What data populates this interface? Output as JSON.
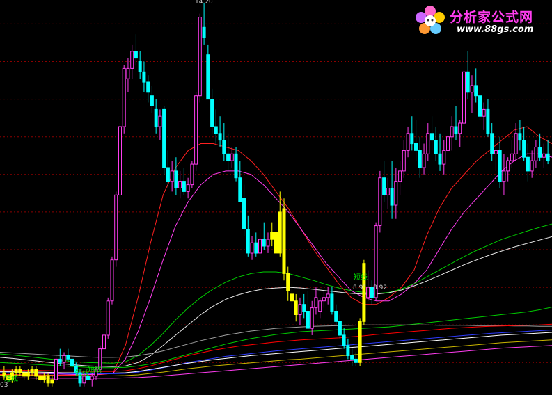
{
  "watermark": {
    "title": "分析家公式网",
    "url": "www.88gs.com",
    "icon": "flower-logo-icon",
    "title_color": "#ff3df0"
  },
  "colors": {
    "up_candle": "#ff3df0",
    "down_candle": "#00ffff",
    "signal_candle": "#ffff00",
    "gridline": "#8b0000"
  },
  "chart_data": {
    "type": "candlestick",
    "ylim": [
      2.75,
      14.3
    ],
    "grid": "horizontal-dotted",
    "gridline_values": [
      13.6,
      12.5,
      11.4,
      10.3,
      9.2,
      8.1,
      7.0,
      5.9,
      4.8,
      3.7,
      2.6
    ],
    "high_label": "14.20",
    "range_label": "8.91 - 8.92",
    "signal_label": "短线",
    "corner_label": "03",
    "candles": [
      [
        3.4,
        3.6,
        3.2,
        3.3
      ],
      [
        3.3,
        3.4,
        3.1,
        3.2
      ],
      [
        3.2,
        3.5,
        3.1,
        3.4
      ],
      [
        3.4,
        3.6,
        3.3,
        3.5
      ],
      [
        3.5,
        3.6,
        3.3,
        3.4
      ],
      [
        3.4,
        3.5,
        3.2,
        3.3
      ],
      [
        3.3,
        3.5,
        3.2,
        3.4
      ],
      [
        3.4,
        3.6,
        3.3,
        3.5
      ],
      [
        3.5,
        3.6,
        3.2,
        3.3
      ],
      [
        3.3,
        3.4,
        3.1,
        3.2
      ],
      [
        3.2,
        3.4,
        3.1,
        3.3
      ],
      [
        3.3,
        3.4,
        3.0,
        3.1
      ],
      [
        3.1,
        3.3,
        3.0,
        3.2
      ],
      [
        3.2,
        3.9,
        3.1,
        3.8
      ],
      [
        3.8,
        4.1,
        3.6,
        3.7
      ],
      [
        3.7,
        4.0,
        3.5,
        3.9
      ],
      [
        3.9,
        4.1,
        3.7,
        3.8
      ],
      [
        3.8,
        3.9,
        3.5,
        3.6
      ],
      [
        3.6,
        3.7,
        3.3,
        3.4
      ],
      [
        3.4,
        3.5,
        3.0,
        3.1
      ],
      [
        3.1,
        3.4,
        3.0,
        3.3
      ],
      [
        3.3,
        3.5,
        3.1,
        3.2
      ],
      [
        3.2,
        3.4,
        3.0,
        3.3
      ],
      [
        3.3,
        3.6,
        3.2,
        3.5
      ],
      [
        3.5,
        4.2,
        3.4,
        4.1
      ],
      [
        4.1,
        4.6,
        4.0,
        4.5
      ],
      [
        4.5,
        5.6,
        4.4,
        5.5
      ],
      [
        5.5,
        6.8,
        5.4,
        6.7
      ],
      [
        6.7,
        8.7,
        6.5,
        8.6
      ],
      [
        8.6,
        10.7,
        8.4,
        10.6
      ],
      [
        10.6,
        12.4,
        10.4,
        12.3
      ],
      [
        12.0,
        12.6,
        11.6,
        12.3
      ],
      [
        12.3,
        13.0,
        12.0,
        12.8
      ],
      [
        12.8,
        13.3,
        12.4,
        12.6
      ],
      [
        12.5,
        12.8,
        12.0,
        12.2
      ],
      [
        12.2,
        12.5,
        11.6,
        11.9
      ],
      [
        11.9,
        12.1,
        11.3,
        11.6
      ],
      [
        11.5,
        11.8,
        11.0,
        11.2
      ],
      [
        11.1,
        11.4,
        10.4,
        10.6
      ],
      [
        10.6,
        11.1,
        10.2,
        10.9
      ],
      [
        11.1,
        11.2,
        9.2,
        9.4
      ],
      [
        9.4,
        9.9,
        8.8,
        9.0
      ],
      [
        9.0,
        9.6,
        8.7,
        9.3
      ],
      [
        9.3,
        9.7,
        8.6,
        8.8
      ],
      [
        8.8,
        9.3,
        8.5,
        9.0
      ],
      [
        9.0,
        9.4,
        8.6,
        8.7
      ],
      [
        8.7,
        9.1,
        8.5,
        8.9
      ],
      [
        8.9,
        9.6,
        8.8,
        9.5
      ],
      [
        9.5,
        11.6,
        9.3,
        11.5
      ],
      [
        11.5,
        13.9,
        11.3,
        13.8
      ],
      [
        13.5,
        14.2,
        13.0,
        13.2
      ],
      [
        12.7,
        13.0,
        11.8,
        11.4
      ],
      [
        11.4,
        11.7,
        10.4,
        10.6
      ],
      [
        10.6,
        11.1,
        10.1,
        10.4
      ],
      [
        10.4,
        10.9,
        10.0,
        10.2
      ],
      [
        10.2,
        10.7,
        9.6,
        9.8
      ],
      [
        9.8,
        10.4,
        9.3,
        9.6
      ],
      [
        9.6,
        10.0,
        9.4,
        9.8
      ],
      [
        9.8,
        10.0,
        9.0,
        9.1
      ],
      [
        9.1,
        9.6,
        8.6,
        8.4
      ],
      [
        8.5,
        8.9,
        7.4,
        7.6
      ],
      [
        7.6,
        8.0,
        6.8,
        6.9
      ],
      [
        6.9,
        7.4,
        6.7,
        7.2
      ],
      [
        7.2,
        7.5,
        6.8,
        6.9
      ],
      [
        6.9,
        7.6,
        6.8,
        7.3
      ],
      [
        7.3,
        7.8,
        7.0,
        7.1
      ],
      [
        7.1,
        7.5,
        6.9,
        7.3
      ],
      [
        7.3,
        7.8,
        7.1,
        7.5
      ],
      [
        7.5,
        7.6,
        6.7,
        6.9
      ],
      [
        6.9,
        8.7,
        6.8,
        8.1
      ],
      [
        8.2,
        8.5,
        6.1,
        6.3
      ],
      [
        6.3,
        6.5,
        5.5,
        5.8
      ],
      [
        5.7,
        6.0,
        5.3,
        5.5
      ],
      [
        5.5,
        5.7,
        4.9,
        5.1
      ],
      [
        5.1,
        5.6,
        4.8,
        5.4
      ],
      [
        5.4,
        5.7,
        5.0,
        5.2
      ],
      [
        5.2,
        5.8,
        4.9,
        4.7
      ],
      [
        4.7,
        5.5,
        4.5,
        5.3
      ],
      [
        5.3,
        5.9,
        5.1,
        5.6
      ],
      [
        5.2,
        5.6,
        5.0,
        5.5
      ],
      [
        5.5,
        5.8,
        5.3,
        5.6
      ],
      [
        5.6,
        5.9,
        5.4,
        5.7
      ],
      [
        5.7,
        5.9,
        5.1,
        5.2
      ],
      [
        5.2,
        5.4,
        4.8,
        4.9
      ],
      [
        4.9,
        5.1,
        4.4,
        4.5
      ],
      [
        4.5,
        4.7,
        4.1,
        4.2
      ],
      [
        4.2,
        4.4,
        3.8,
        3.9
      ],
      [
        3.9,
        4.1,
        3.6,
        3.8
      ],
      [
        3.8,
        4.0,
        3.6,
        3.7
      ],
      [
        3.7,
        5.0,
        3.6,
        4.9
      ],
      [
        4.9,
        6.7,
        4.8,
        6.6
      ],
      [
        5.6,
        6.4,
        5.5,
        5.9
      ],
      [
        5.9,
        6.1,
        5.4,
        5.6
      ],
      [
        5.6,
        7.8,
        5.5,
        7.7
      ],
      [
        7.7,
        9.3,
        7.5,
        9.1
      ],
      [
        9.1,
        9.6,
        8.4,
        8.6
      ],
      [
        8.6,
        9.1,
        8.2,
        8.8
      ],
      [
        8.8,
        9.6,
        7.9,
        8.3
      ],
      [
        8.3,
        9.4,
        7.9,
        9.0
      ],
      [
        9.0,
        9.6,
        8.6,
        9.3
      ],
      [
        9.3,
        10.2,
        9.1,
        9.9
      ],
      [
        9.9,
        10.6,
        9.7,
        10.4
      ],
      [
        10.4,
        10.9,
        9.9,
        10.1
      ],
      [
        10.1,
        10.8,
        9.6,
        9.9
      ],
      [
        9.9,
        10.3,
        9.1,
        9.4
      ],
      [
        9.4,
        10.1,
        9.2,
        9.8
      ],
      [
        9.8,
        10.7,
        9.6,
        10.4
      ],
      [
        10.4,
        10.9,
        9.9,
        10.2
      ],
      [
        10.2,
        10.6,
        9.6,
        9.8
      ],
      [
        9.8,
        10.4,
        9.3,
        9.5
      ],
      [
        9.5,
        10.2,
        9.2,
        9.9
      ],
      [
        9.9,
        10.6,
        9.6,
        10.3
      ],
      [
        10.3,
        10.9,
        9.9,
        10.6
      ],
      [
        10.6,
        11.2,
        10.2,
        10.4
      ],
      [
        10.4,
        10.8,
        10.0,
        10.7
      ],
      [
        10.7,
        12.6,
        10.5,
        12.2
      ],
      [
        12.2,
        12.8,
        11.4,
        11.6
      ],
      [
        11.6,
        12.1,
        11.0,
        11.8
      ],
      [
        11.8,
        12.3,
        11.3,
        11.5
      ],
      [
        11.5,
        11.8,
        10.8,
        10.9
      ],
      [
        10.9,
        11.3,
        10.5,
        11.1
      ],
      [
        11.1,
        11.4,
        10.3,
        10.4
      ],
      [
        10.4,
        10.7,
        9.6,
        9.8
      ],
      [
        9.8,
        10.2,
        9.3,
        9.9
      ],
      [
        9.9,
        10.3,
        8.8,
        9.0
      ],
      [
        9.0,
        9.8,
        8.6,
        9.3
      ],
      [
        9.3,
        9.7,
        9.0,
        9.6
      ],
      [
        9.6,
        10.2,
        9.4,
        9.8
      ],
      [
        9.8,
        10.7,
        9.6,
        10.4
      ],
      [
        10.4,
        10.8,
        9.9,
        10.2
      ],
      [
        10.2,
        10.6,
        9.6,
        9.7
      ],
      [
        9.7,
        10.1,
        9.0,
        9.3
      ],
      [
        9.3,
        9.9,
        9.1,
        9.6
      ],
      [
        9.6,
        10.2,
        9.4,
        10.0
      ],
      [
        10.0,
        10.4,
        9.6,
        9.7
      ],
      [
        9.7,
        10.1,
        9.4,
        9.8
      ],
      [
        9.8,
        10.2,
        9.5,
        9.6
      ]
    ],
    "signal_bars": [
      0,
      1,
      2,
      3,
      4,
      5,
      6,
      7,
      8,
      9,
      10,
      11,
      12,
      67,
      68,
      69,
      70,
      71,
      72,
      73,
      89,
      90
    ],
    "series": [
      {
        "color": "#ff2020",
        "values": [
          3.35,
          3.35,
          3.34,
          3.34,
          3.33,
          3.33,
          3.33,
          3.34,
          3.35,
          3.38,
          4.2,
          5.6,
          7.2,
          8.6,
          9.4,
          9.9,
          10.1,
          10.1,
          10.0,
          9.9,
          9.6,
          9.2,
          8.7,
          8.2,
          7.6,
          7.0,
          6.5,
          6.0,
          5.6,
          5.4,
          5.4,
          5.6,
          5.9,
          6.4,
          7.4,
          8.2,
          8.8,
          9.2,
          9.6,
          9.9,
          10.2,
          10.5,
          10.6,
          10.3,
          10.1
        ]
      },
      {
        "color": "#ff3df0",
        "values": [
          3.4,
          3.4,
          3.39,
          3.38,
          3.37,
          3.36,
          3.35,
          3.35,
          3.36,
          3.38,
          3.8,
          4.6,
          5.6,
          6.7,
          7.7,
          8.4,
          8.9,
          9.2,
          9.3,
          9.3,
          9.2,
          8.9,
          8.5,
          8.1,
          7.6,
          7.1,
          6.6,
          6.2,
          5.8,
          5.6,
          5.5,
          5.5,
          5.7,
          6.0,
          6.4,
          7.0,
          7.6,
          8.1,
          8.5,
          8.9,
          9.3,
          9.6,
          9.8,
          9.8,
          9.7
        ]
      },
      {
        "color": "#00cc00",
        "values": [
          3.95,
          3.92,
          3.88,
          3.84,
          3.8,
          3.76,
          3.72,
          3.7,
          3.69,
          3.68,
          3.72,
          3.9,
          4.2,
          4.55,
          4.95,
          5.3,
          5.6,
          5.85,
          6.05,
          6.2,
          6.3,
          6.35,
          6.35,
          6.3,
          6.2,
          6.1,
          5.98,
          5.88,
          5.8,
          5.75,
          5.72,
          5.75,
          5.85,
          6.0,
          6.2,
          6.4,
          6.6,
          6.8,
          6.98,
          7.14,
          7.3,
          7.42,
          7.54,
          7.65,
          7.75
        ]
      },
      {
        "color": "#e8e8e8",
        "values": [
          3.85,
          3.82,
          3.78,
          3.74,
          3.7,
          3.66,
          3.63,
          3.6,
          3.59,
          3.58,
          3.6,
          3.7,
          3.9,
          4.2,
          4.5,
          4.8,
          5.1,
          5.35,
          5.55,
          5.68,
          5.78,
          5.85,
          5.88,
          5.9,
          5.88,
          5.84,
          5.8,
          5.76,
          5.72,
          5.7,
          5.7,
          5.74,
          5.82,
          5.94,
          6.08,
          6.24,
          6.4,
          6.56,
          6.7,
          6.84,
          6.96,
          7.08,
          7.18,
          7.28,
          7.38
        ]
      },
      {
        "color": "#00cc00",
        "values": [
          3.7,
          3.68,
          3.66,
          3.64,
          3.62,
          3.6,
          3.58,
          3.56,
          3.55,
          3.55,
          3.56,
          3.6,
          3.66,
          3.74,
          3.84,
          3.94,
          4.04,
          4.14,
          4.24,
          4.32,
          4.4,
          4.46,
          4.52,
          4.56,
          4.6,
          4.62,
          4.64,
          4.66,
          4.68,
          4.7,
          4.72,
          4.74,
          4.78,
          4.82,
          4.86,
          4.9,
          4.94,
          4.98,
          5.02,
          5.06,
          5.1,
          5.14,
          5.18,
          5.24,
          5.32
        ]
      },
      {
        "color": "#a0a0a0",
        "values": [
          4.0,
          3.98,
          3.96,
          3.94,
          3.92,
          3.9,
          3.88,
          3.86,
          3.85,
          3.85,
          3.86,
          3.9,
          3.96,
          4.04,
          4.14,
          4.24,
          4.34,
          4.42,
          4.5,
          4.56,
          4.62,
          4.66,
          4.7,
          4.72,
          4.74,
          4.76,
          4.77,
          4.78,
          4.79,
          4.8,
          4.8,
          4.8,
          4.8,
          4.8,
          4.8,
          4.79,
          4.79,
          4.79,
          4.78,
          4.78,
          4.78,
          4.77,
          4.77,
          4.76,
          4.76
        ]
      },
      {
        "color": "#ff0000",
        "values": [
          3.48,
          3.48,
          3.47,
          3.47,
          3.46,
          3.45,
          3.45,
          3.44,
          3.44,
          3.44,
          3.46,
          3.52,
          3.6,
          3.7,
          3.8,
          3.9,
          3.98,
          4.06,
          4.12,
          4.18,
          4.22,
          4.26,
          4.3,
          4.33,
          4.36,
          4.38,
          4.4,
          4.42,
          4.45,
          4.48,
          4.52,
          4.55,
          4.58,
          4.61,
          4.64,
          4.67,
          4.7,
          4.72,
          4.74,
          4.76,
          4.77,
          4.78,
          4.79,
          4.8,
          4.82
        ]
      },
      {
        "color": "#2e3cff",
        "values": [
          3.4,
          3.4,
          3.39,
          3.39,
          3.38,
          3.38,
          3.37,
          3.37,
          3.37,
          3.37,
          3.38,
          3.42,
          3.48,
          3.55,
          3.62,
          3.7,
          3.76,
          3.82,
          3.88,
          3.92,
          3.96,
          4.0,
          4.04,
          4.07,
          4.1,
          4.13,
          4.16,
          4.19,
          4.22,
          4.25,
          4.28,
          4.31,
          4.34,
          4.37,
          4.4,
          4.43,
          4.46,
          4.49,
          4.52,
          4.55,
          4.57,
          4.59,
          4.61,
          4.63,
          4.65
        ]
      },
      {
        "color": "#ffffff",
        "values": [
          3.43,
          3.43,
          3.42,
          3.42,
          3.41,
          3.4,
          3.4,
          3.39,
          3.39,
          3.39,
          3.4,
          3.44,
          3.5,
          3.56,
          3.62,
          3.68,
          3.73,
          3.78,
          3.82,
          3.86,
          3.9,
          3.93,
          3.96,
          3.99,
          4.02,
          4.05,
          4.08,
          4.11,
          4.14,
          4.17,
          4.2,
          4.23,
          4.26,
          4.29,
          4.32,
          4.35,
          4.38,
          4.41,
          4.44,
          4.47,
          4.5,
          4.52,
          4.54,
          4.56,
          4.58
        ]
      },
      {
        "color": "#c8b400",
        "values": [
          3.33,
          3.33,
          3.32,
          3.32,
          3.32,
          3.31,
          3.31,
          3.31,
          3.31,
          3.31,
          3.32,
          3.34,
          3.38,
          3.42,
          3.47,
          3.52,
          3.56,
          3.6,
          3.63,
          3.66,
          3.69,
          3.72,
          3.75,
          3.78,
          3.8,
          3.83,
          3.86,
          3.89,
          3.92,
          3.95,
          3.98,
          4.01,
          4.04,
          4.07,
          4.1,
          4.13,
          4.16,
          4.19,
          4.22,
          4.25,
          4.28,
          4.3,
          4.32,
          4.34,
          4.36
        ]
      },
      {
        "color": "#ff3df0",
        "values": [
          3.25,
          3.25,
          3.25,
          3.24,
          3.24,
          3.24,
          3.24,
          3.24,
          3.24,
          3.24,
          3.25,
          3.26,
          3.28,
          3.31,
          3.34,
          3.37,
          3.4,
          3.43,
          3.46,
          3.49,
          3.52,
          3.55,
          3.58,
          3.61,
          3.64,
          3.67,
          3.7,
          3.73,
          3.76,
          3.79,
          3.82,
          3.85,
          3.88,
          3.91,
          3.94,
          3.97,
          4.0,
          4.03,
          4.06,
          4.09,
          4.12,
          4.14,
          4.16,
          4.18,
          4.2
        ]
      }
    ]
  }
}
